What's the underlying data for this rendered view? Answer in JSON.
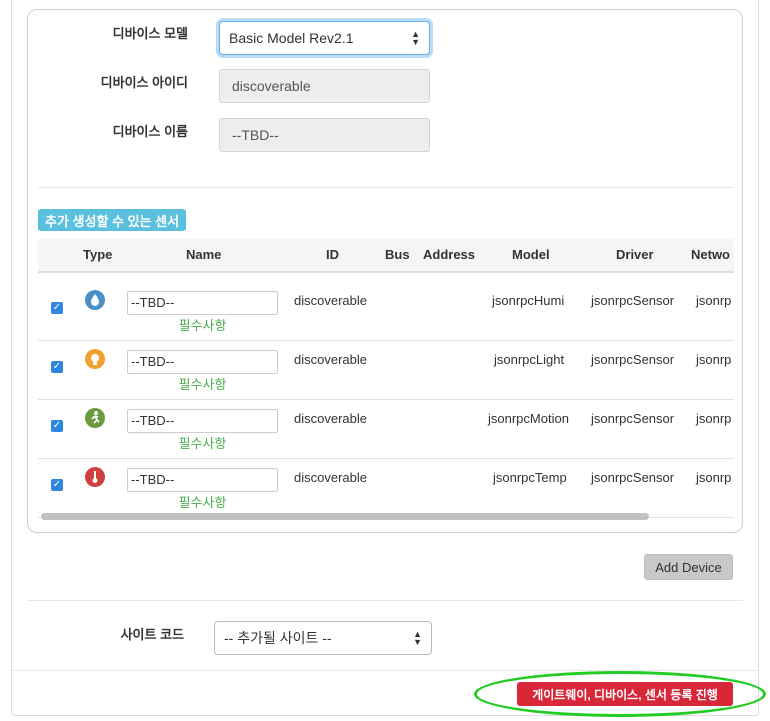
{
  "device_form": {
    "model_label": "디바이스 모델",
    "model_value": "Basic Model Rev2.1",
    "id_label": "디바이스 아이디",
    "id_value": "discoverable",
    "name_label": "디바이스 이름",
    "name_value": "--TBD--"
  },
  "sensors": {
    "section_title": "추가 생성할 수 있는 센서",
    "headers": {
      "type": "Type",
      "name": "Name",
      "id": "ID",
      "bus": "Bus",
      "address": "Address",
      "model": "Model",
      "driver": "Driver",
      "network": "Netwo"
    },
    "rows": [
      {
        "checked": true,
        "icon": "humidity-drop-icon",
        "icon_color": "#4a90c8",
        "name": "--TBD--",
        "required": "필수사항",
        "id": "discoverable",
        "model": "jsonrpcHumi",
        "driver": "jsonrpcSensor",
        "network": "jsonrp"
      },
      {
        "checked": true,
        "icon": "light-bulb-icon",
        "icon_color": "#f0a030",
        "name": "--TBD--",
        "required": "필수사항",
        "id": "discoverable",
        "model": "jsonrpcLight",
        "driver": "jsonrpcSensor",
        "network": "jsonrp"
      },
      {
        "checked": true,
        "icon": "motion-runner-icon",
        "icon_color": "#6b9a3e",
        "name": "--TBD--",
        "required": "필수사항",
        "id": "discoverable",
        "model": "jsonrpcMotion",
        "driver": "jsonrpcSensor",
        "network": "jsonrp"
      },
      {
        "checked": true,
        "icon": "thermometer-icon",
        "icon_color": "#d04040",
        "name": "--TBD--",
        "required": "필수사항",
        "id": "discoverable",
        "model": "jsonrpcTemp",
        "driver": "jsonrpcSensor",
        "network": "jsonrp"
      }
    ]
  },
  "add_device_label": "Add Device",
  "site": {
    "label": "사이트 코드",
    "value": "-- 추가될 사이트 --"
  },
  "submit_label": "게이트웨이, 디바이스, 센서 등록 진행",
  "colors": {
    "accent_blue": "#5bc0de",
    "submit_red": "#d9273a",
    "required_green": "#4cae4c",
    "highlight_green": "#22cc22"
  }
}
